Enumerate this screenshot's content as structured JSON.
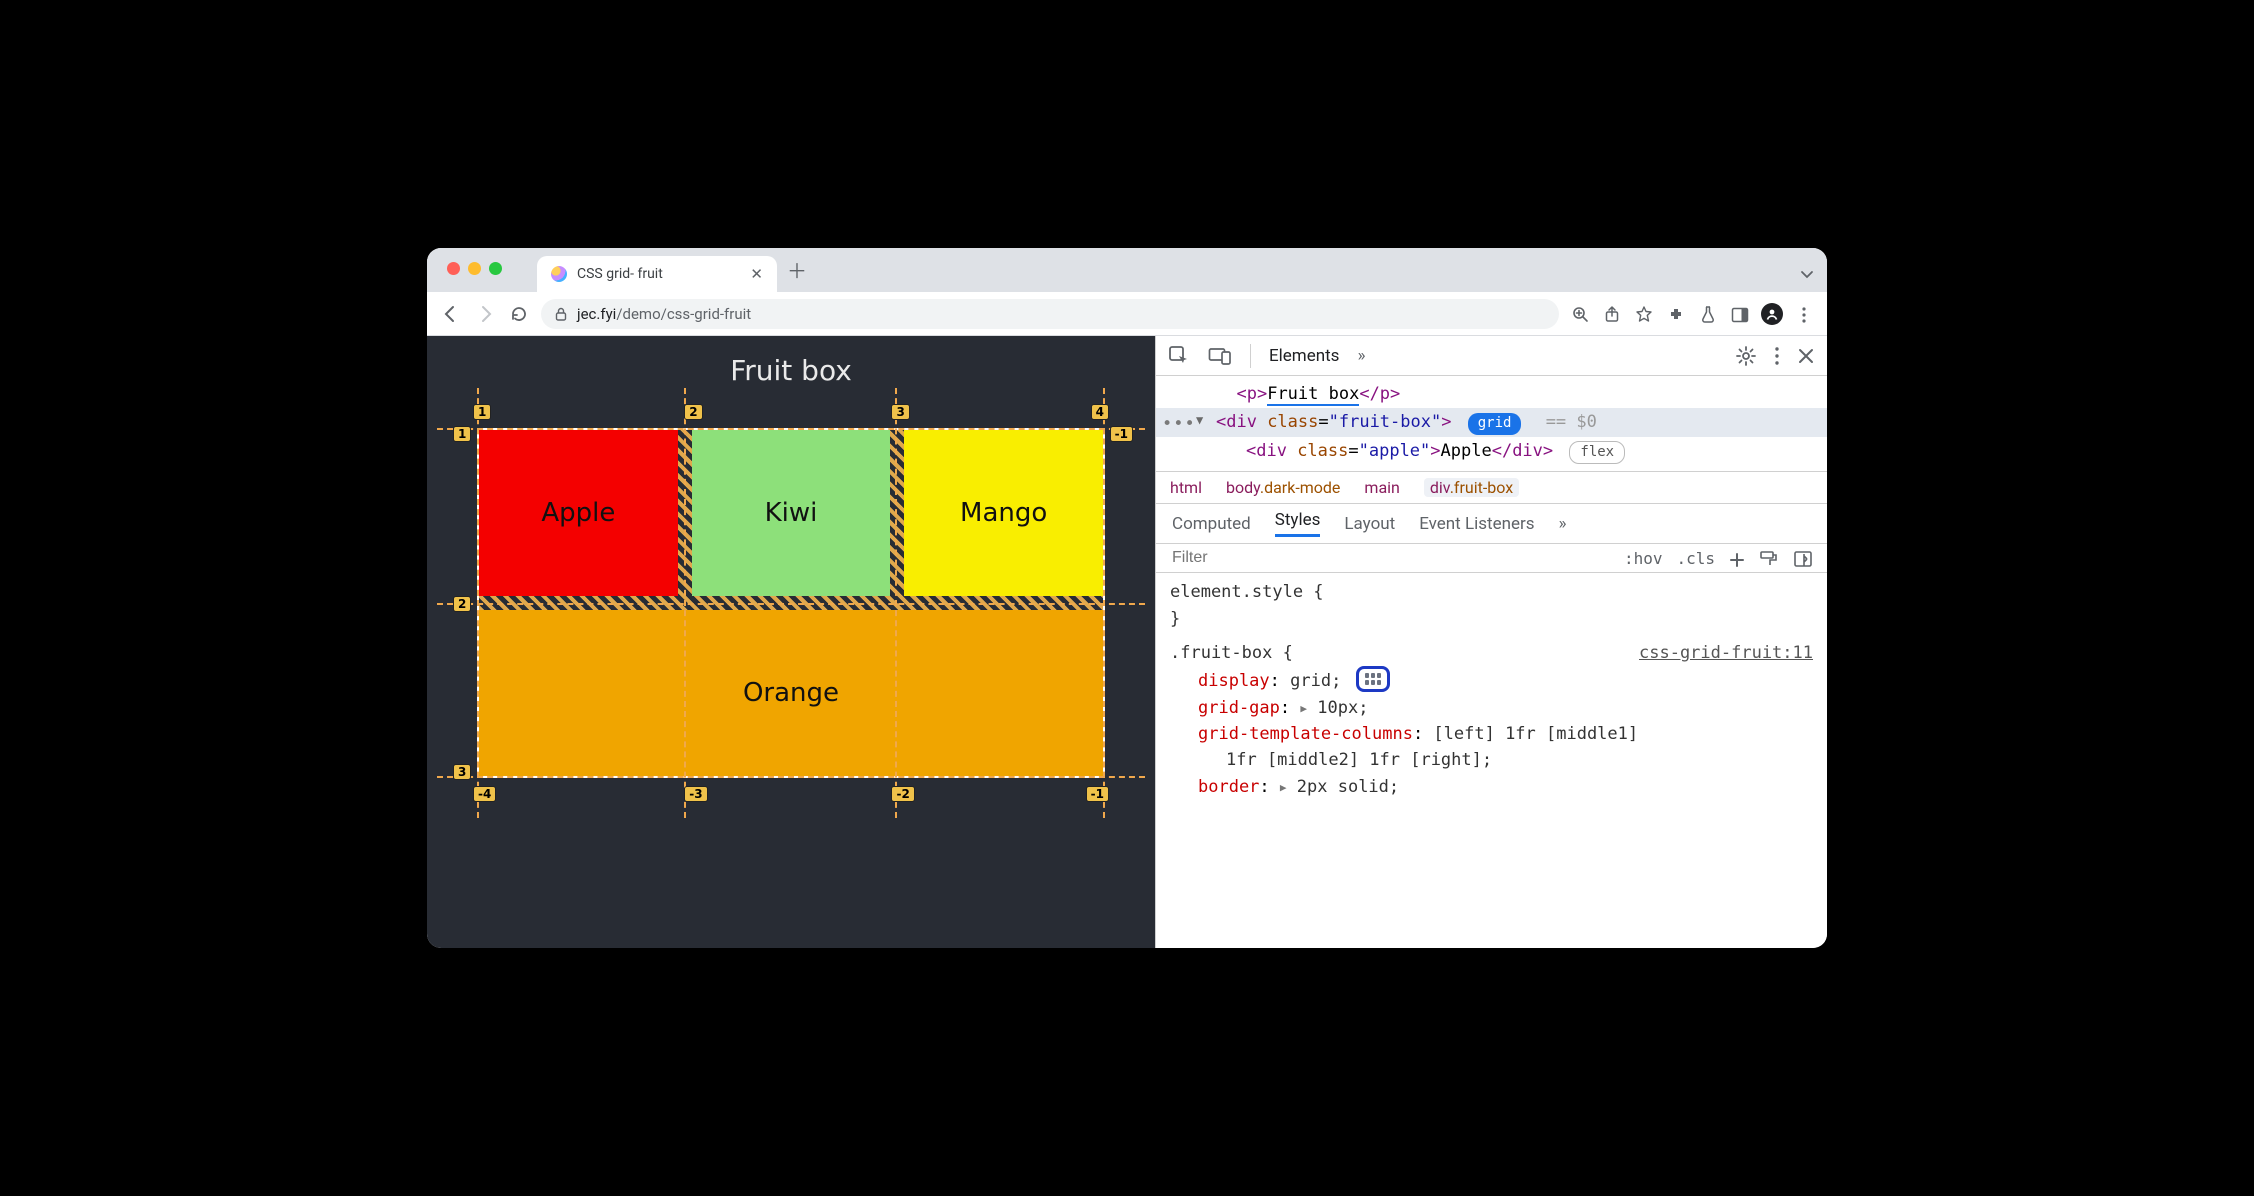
{
  "browser": {
    "tab_title": "CSS grid- fruit",
    "url_host": "jec.fyi",
    "url_path": "/demo/css-grid-fruit"
  },
  "page": {
    "heading": "Fruit box",
    "cells": {
      "apple": "Apple",
      "kiwi": "Kiwi",
      "mango": "Mango",
      "orange": "Orange"
    },
    "col_lines": [
      "1",
      "2",
      "3",
      "4"
    ],
    "col_lines_neg": [
      "-4",
      "-3",
      "-2",
      "-1"
    ],
    "row_lines": [
      "1",
      "2",
      "3"
    ],
    "row_lines_neg": [
      "-1"
    ]
  },
  "devtools": {
    "main_tabs": {
      "elements": "Elements",
      "more": "»"
    },
    "dom": {
      "l1": {
        "open": "<p>",
        "text": "Fruit box",
        "close": "</p>"
      },
      "l2": {
        "text": "<div class=\"fruit-box\">",
        "badge": "grid",
        "meta": "== $0"
      },
      "l3": {
        "text": "<div class=\"apple\">Apple</div>",
        "badge": "flex"
      }
    },
    "crumbs": [
      "html",
      "body.dark-mode",
      "main",
      "div.fruit-box"
    ],
    "subtabs": [
      "Computed",
      "Styles",
      "Layout",
      "Event Listeners",
      "»"
    ],
    "stylesbar": {
      "filter_ph": "Filter",
      "hov": ":hov",
      "cls": ".cls"
    },
    "rules": {
      "element_style": "element.style {",
      "element_style_close": "}",
      "selector": ".fruit-box {",
      "source": "css-grid-fruit:11",
      "props": {
        "display": {
          "name": "display",
          "value": "grid;"
        },
        "gap": {
          "name": "grid-gap",
          "value": "10px;"
        },
        "gtc": {
          "name": "grid-template-columns",
          "value": "[left] 1fr [middle1]"
        },
        "gtc2": "1fr [middle2] 1fr [right];",
        "border": {
          "name": "border",
          "value": "2px solid;"
        }
      }
    }
  }
}
